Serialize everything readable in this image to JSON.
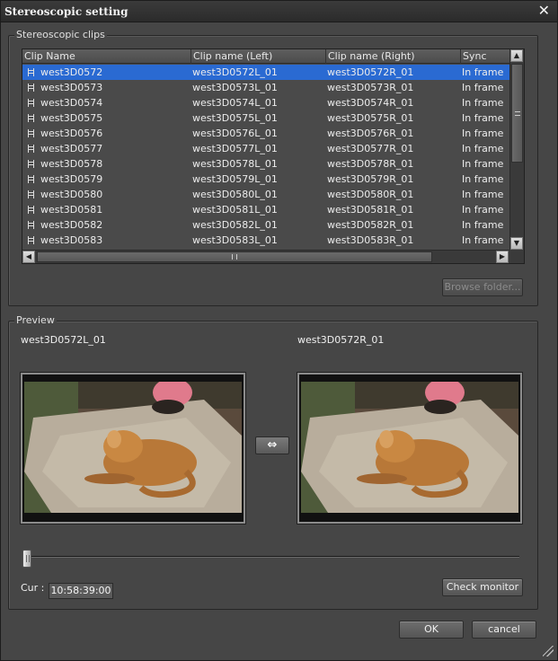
{
  "window": {
    "title": "Stereoscopic setting",
    "close_symbol": "✕"
  },
  "clips_group": {
    "label": "Stereoscopic clips",
    "columns": [
      "Clip Name",
      "Clip name (Left)",
      "Clip name (Right)",
      "Sync"
    ],
    "rows": [
      {
        "name": "west3D0572",
        "left": "west3D0572L_01",
        "right": "west3D0572R_01",
        "sync": "In frame"
      },
      {
        "name": "west3D0573",
        "left": "west3D0573L_01",
        "right": "west3D0573R_01",
        "sync": "In frame"
      },
      {
        "name": "west3D0574",
        "left": "west3D0574L_01",
        "right": "west3D0574R_01",
        "sync": "In frame"
      },
      {
        "name": "west3D0575",
        "left": "west3D0575L_01",
        "right": "west3D0575R_01",
        "sync": "In frame"
      },
      {
        "name": "west3D0576",
        "left": "west3D0576L_01",
        "right": "west3D0576R_01",
        "sync": "In frame"
      },
      {
        "name": "west3D0577",
        "left": "west3D0577L_01",
        "right": "west3D0577R_01",
        "sync": "In frame"
      },
      {
        "name": "west3D0578",
        "left": "west3D0578L_01",
        "right": "west3D0578R_01",
        "sync": "In frame"
      },
      {
        "name": "west3D0579",
        "left": "west3D0579L_01",
        "right": "west3D0579R_01",
        "sync": "In frame"
      },
      {
        "name": "west3D0580",
        "left": "west3D0580L_01",
        "right": "west3D0580R_01",
        "sync": "In frame"
      },
      {
        "name": "west3D0581",
        "left": "west3D0581L_01",
        "right": "west3D0581R_01",
        "sync": "In frame"
      },
      {
        "name": "west3D0582",
        "left": "west3D0582L_01",
        "right": "west3D0582R_01",
        "sync": "In frame"
      },
      {
        "name": "west3D0583",
        "left": "west3D0583L_01",
        "right": "west3D0583R_01",
        "sync": "In frame"
      }
    ],
    "selected_index": 0,
    "browse_label": "Browse folder..."
  },
  "preview": {
    "label": "Preview",
    "left_clip": "west3D0572L_01",
    "right_clip": "west3D0572R_01",
    "swap_symbol": "⇔",
    "cur_label": "Cur :",
    "timecode": "10:58:39:00",
    "check_monitor_label": "Check monitor",
    "position_fraction": 0.0
  },
  "footer": {
    "ok_label": "OK",
    "cancel_label": "cancel"
  },
  "colors": {
    "selection": "#2a6ad2",
    "panel": "#464646"
  }
}
